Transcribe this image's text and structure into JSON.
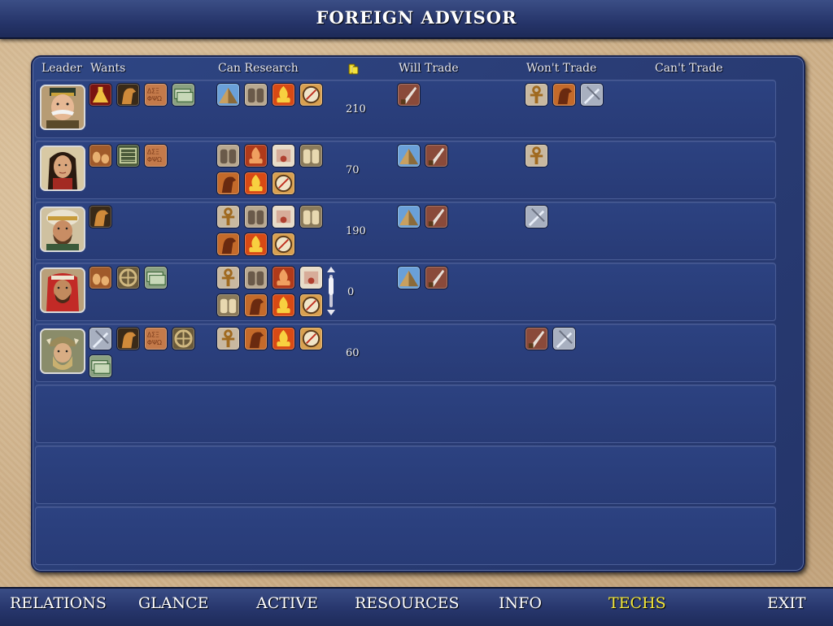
{
  "window": {
    "title": "FOREIGN ADVISOR"
  },
  "columns": {
    "leader": "Leader",
    "wants": "Wants",
    "can_research": "Can Research",
    "gold_icon": "gold-coins-icon",
    "will_trade": "Will Trade",
    "wont_trade": "Won't Trade",
    "cant_trade": "Can't Trade"
  },
  "rows": [
    {
      "leader": "leader-portrait-general",
      "gold": "210",
      "wants": [
        "tech-alchemy-icon",
        "tech-horseman-icon",
        "tech-writing-icon",
        "tech-currency-icon"
      ],
      "can_research": [
        "tech-masonry-icon",
        "tech-code-of-laws-icon",
        "tech-bronze-working-icon",
        "tech-navigation-icon"
      ],
      "will_trade": [
        "tech-warrior-code-icon"
      ],
      "wont_trade": [
        "tech-ceremonial-burial-icon",
        "tech-horseback-riding-icon",
        "tech-iron-working-icon"
      ],
      "cant_trade": []
    },
    {
      "leader": "leader-portrait-queen",
      "gold": "70",
      "wants": [
        "tech-pottery-icon",
        "tech-alphabet-icon",
        "tech-writing-icon"
      ],
      "can_research": [
        "tech-code-of-laws-icon",
        "tech-mysticism-icon",
        "tech-mathematics-icon",
        "tech-literature-icon",
        "tech-horseback-riding-icon",
        "tech-bronze-working-icon",
        "tech-navigation-icon"
      ],
      "will_trade": [
        "tech-masonry-icon",
        "tech-warrior-code-icon"
      ],
      "wont_trade": [
        "tech-ceremonial-burial-icon"
      ],
      "cant_trade": []
    },
    {
      "leader": "leader-portrait-sultan",
      "gold": "190",
      "wants": [
        "tech-horseman-icon"
      ],
      "can_research": [
        "tech-ceremonial-burial-icon",
        "tech-code-of-laws-icon",
        "tech-mathematics-icon",
        "tech-literature-icon",
        "tech-horseback-riding-icon",
        "tech-bronze-working-icon",
        "tech-navigation-icon"
      ],
      "will_trade": [
        "tech-masonry-icon",
        "tech-warrior-code-icon"
      ],
      "wont_trade": [
        "tech-iron-working-icon"
      ],
      "cant_trade": []
    },
    {
      "leader": "leader-portrait-sheikh",
      "gold": "0",
      "wants": [
        "tech-pottery-icon",
        "tech-the-wheel-icon",
        "tech-currency-icon"
      ],
      "can_research": [
        "tech-ceremonial-burial-icon",
        "tech-code-of-laws-icon",
        "tech-mysticism-icon",
        "tech-mathematics-icon",
        "tech-literature-icon",
        "tech-horseback-riding-icon",
        "tech-bronze-working-icon",
        "tech-navigation-icon"
      ],
      "will_trade": [
        "tech-masonry-icon",
        "tech-warrior-code-icon"
      ],
      "wont_trade": [],
      "cant_trade": []
    },
    {
      "leader": "leader-portrait-viking",
      "gold": "60",
      "wants": [
        "tech-iron-working-icon",
        "tech-horseman-icon",
        "tech-writing-icon",
        "tech-the-wheel-icon",
        "tech-currency-icon"
      ],
      "can_research": [
        "tech-ceremonial-burial-icon",
        "tech-horseback-riding-icon",
        "tech-bronze-working-icon",
        "tech-navigation-icon"
      ],
      "will_trade": [],
      "wont_trade": [
        "tech-warrior-code-icon",
        "tech-iron-working-icon"
      ],
      "cant_trade": []
    }
  ],
  "nav": {
    "relations": "RELATIONS",
    "glance": "GLANCE",
    "active": "ACTIVE",
    "resources": "RESOURCES",
    "info": "INFO",
    "techs": "TECHS",
    "exit": "EXIT",
    "active_tab": "TECHS",
    "active_color": "#f4e83a"
  }
}
